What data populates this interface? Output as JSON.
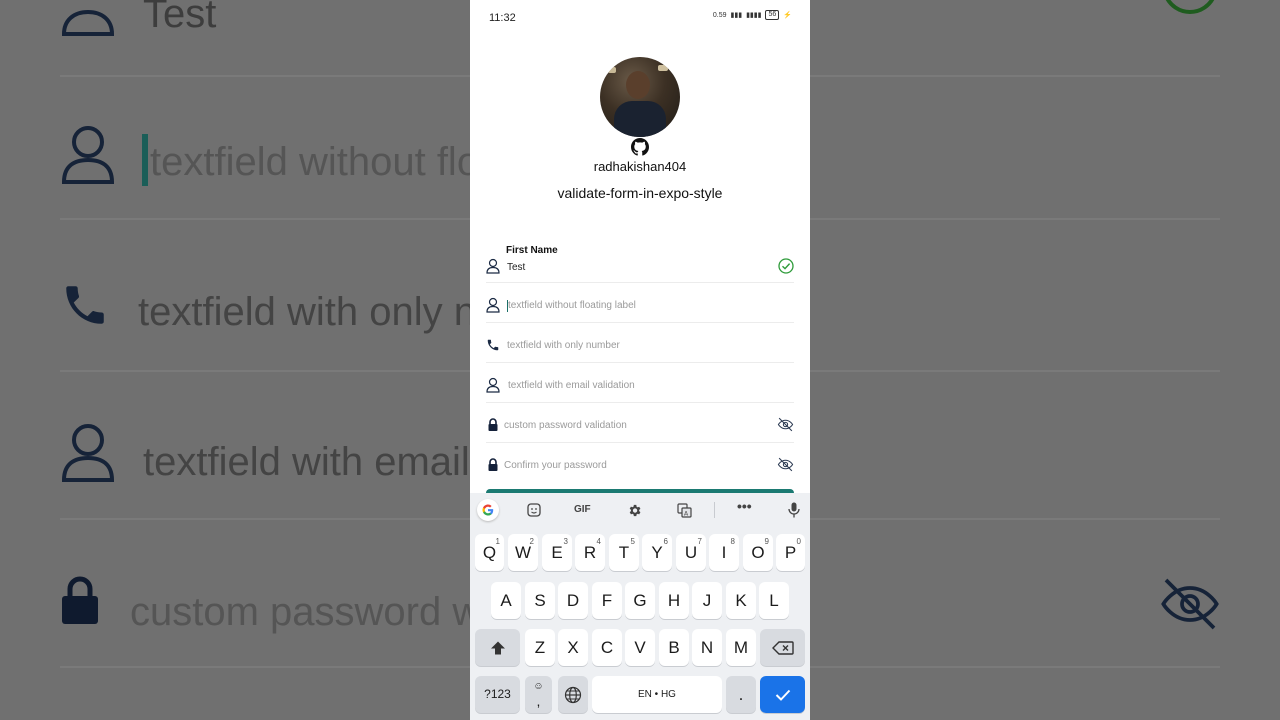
{
  "status_bar": {
    "time": "11:32",
    "speed": "0.59",
    "battery": "56"
  },
  "profile": {
    "username": "radhakishan404",
    "repo": "validate-form-in-expo-style"
  },
  "form": {
    "first_name": {
      "label": "First Name",
      "value": "Test"
    },
    "no_float": {
      "placeholder": "textfield without floating label"
    },
    "number": {
      "placeholder": "textfield with only number"
    },
    "email": {
      "placeholder": "textfield with email validation"
    },
    "password": {
      "placeholder": "custom password validation"
    },
    "confirm": {
      "placeholder": "Confirm your password"
    }
  },
  "background": {
    "rows": [
      "Test",
      "textfield without flo",
      "textfield with only n",
      "textfield with email",
      "custom password w"
    ]
  },
  "keyboard": {
    "toolbar": {
      "gif": "GIF"
    },
    "row1": [
      {
        "k": "Q",
        "n": "1"
      },
      {
        "k": "W",
        "n": "2"
      },
      {
        "k": "E",
        "n": "3"
      },
      {
        "k": "R",
        "n": "4"
      },
      {
        "k": "T",
        "n": "5"
      },
      {
        "k": "Y",
        "n": "6"
      },
      {
        "k": "U",
        "n": "7"
      },
      {
        "k": "I",
        "n": "8"
      },
      {
        "k": "O",
        "n": "9"
      },
      {
        "k": "P",
        "n": "0"
      }
    ],
    "row2": [
      "A",
      "S",
      "D",
      "F",
      "G",
      "H",
      "J",
      "K",
      "L"
    ],
    "row3": [
      "Z",
      "X",
      "C",
      "V",
      "B",
      "N",
      "M"
    ],
    "sym_label": "?123",
    "comma": ",",
    "space_label": "EN • HG",
    "period": "."
  }
}
